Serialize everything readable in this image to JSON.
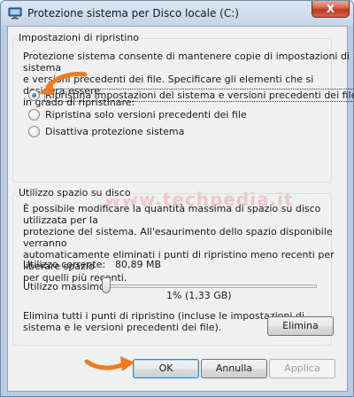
{
  "window": {
    "title": "Protezione sistema per Disco locale (C:)",
    "close_label": "X"
  },
  "restore_group": {
    "legend": "Impostazioni di ripristino",
    "description_lines": [
      "Protezione sistema consente di mantenere copie di impostazioni di sistema",
      "e versioni precedenti dei file. Specificare gli elementi che si desidera essere",
      "in grado di ripristinare:"
    ],
    "options": [
      {
        "label": "Ripristina impostazioni del sistema e versioni precedenti dei file",
        "checked": true
      },
      {
        "label": "Ripristina solo versioni precedenti dei file",
        "checked": false
      },
      {
        "label": "Disattiva protezione sistema",
        "checked": false
      }
    ]
  },
  "watermark": "www.techpedia.it",
  "disk_group": {
    "legend": "Utilizzo spazio su disco",
    "description_lines": [
      "È possibile modificare la quantità massima di spazio su disco utilizzata per la",
      "protezione del sistema. All'esaurimento dello spazio disponibile verranno",
      "automaticamente eliminati i punti di ripristino meno recenti per liberare spazio",
      "per quelli più recenti."
    ],
    "current_label": "Utilizzo corrente:",
    "current_value": "80,89 MB",
    "max_label": "Utilizzo massimo:",
    "max_value": "1% (1,33 GB)",
    "slider_percent": 1,
    "delete_description_lines": [
      "Elimina tutti i punti di ripristino (incluse le impostazioni di",
      "sistema e le versioni precedenti dei file)."
    ],
    "delete_button": "Elimina"
  },
  "footer": {
    "ok": "OK",
    "cancel": "Annulla",
    "apply": "Applica"
  },
  "colors": {
    "accent_arrow": "#f07a1e",
    "titlebar": "#c6d6e8",
    "close": "#c0391f"
  },
  "icons": {
    "app": "computer-shield-icon",
    "close": "close-icon"
  }
}
